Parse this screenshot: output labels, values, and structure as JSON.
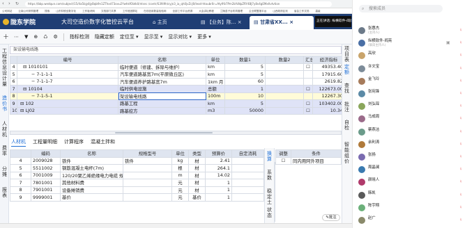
{
  "browser": {
    "url": "https://bbp.wedqun.com/subject/15/4a5bjy8jyBqb9n1ZThxd73ovu2YwhkfObtk0/ntsnc /contr/S39i9h/cyjn3_ia_qh0jvZcJ0/leod-htoubr0r=Aty9fz7Pm2b%NpZRY4BJ7y8v4gEMxtlvtvtion",
    "bookmarks": [
      "公司网站",
      "云南公司采购管理",
      "搜索",
      "山东财税全数字化",
      "工作板块网",
      "文档部门共享",
      "工作班团群站",
      "在线信用数量检验网",
      "全部工作平台资源",
      "大会讲坛教程",
      "兰陵县子台机构管理",
      "企业联盟报平台",
      "山西政府区划",
      "省会工作文档",
      "高级"
    ]
  },
  "app": {
    "logo": "陇东学院",
    "title": "大司空造价数字化管控云平台",
    "tabs": [
      {
        "label": "主页"
      },
      {
        "label": "【业务】陈..."
      },
      {
        "label": "甘肃省XX..."
      }
    ],
    "right_badge": "正在讲话: 纵横软件-阎亮"
  },
  "toolbar": {
    "items": [
      "十",
      "⋯",
      "▼",
      "⊕",
      "♺",
      "⚙",
      "指标检测",
      "隐藏定额",
      "定位至 ▾",
      "显示至 ▾",
      "显示对比 ▾",
      "更多 ▾"
    ]
  },
  "leftnav": {
    "items": [
      "工程信息",
      "设计量",
      "造价书",
      "人材机",
      "费率",
      "分摊",
      "报表"
    ]
  },
  "editbar": {
    "value": "架设输电线路"
  },
  "main_grid": {
    "headers": [
      "",
      "编号",
      "名称",
      "单位",
      "数量1",
      "数量2",
      "汇总",
      "经济指标",
      "金额"
    ],
    "rows": [
      {
        "no": "4",
        "code": "⊟  1010101",
        "name": "临时便道（修建、拆除与维护）",
        "unit": "km",
        "q1": "5",
        "q2": "",
        "sum": "☐",
        "eco": "49353.40",
        "amt": "",
        "style": "normal"
      },
      {
        "no": "5",
        "code": "− 7-1-1-1",
        "name": "汽车便道路基宽7m(平原微丘区)",
        "unit": "km",
        "q1": "5",
        "q2": "",
        "sum": "",
        "eco": "17915.60",
        "amt": "",
        "style": "normal"
      },
      {
        "no": "6",
        "code": "− 7-1-1-7",
        "name": "汽车便道养护路基宽7m",
        "unit": "1km 月",
        "q1": "60",
        "q2": "",
        "sum": "",
        "eco": "2619.82",
        "amt": "",
        "style": "normal"
      },
      {
        "no": "7",
        "code": "⊟  10104",
        "name": "临时供电设施",
        "unit": "总额",
        "q1": "1",
        "q2": "",
        "sum": "☐",
        "eco": "122673.00",
        "amt": "",
        "style": "blue"
      },
      {
        "no": "8",
        "code": "− 7-1-5-1",
        "name": "架设输电线路",
        "unit": "100m",
        "q1": "10",
        "q2": "",
        "sum": "",
        "eco": "12267.30",
        "amt": "",
        "style": "yellow"
      },
      {
        "no": "9",
        "code": "⊟  102",
        "name": "路基工程",
        "unit": "km",
        "q1": "5",
        "q2": "",
        "sum": "☐",
        "eco": "103402.00",
        "amt": "",
        "style": "blue"
      },
      {
        "no": "10",
        "code": "⊟  LJ02",
        "name": "路基挖方",
        "unit": "m3",
        "q1": "50000",
        "q2": "",
        "sum": "☐",
        "eco": "10.34",
        "amt": "",
        "style": "blue"
      }
    ]
  },
  "lower_tabs": [
    "人材机",
    "工程量明细",
    "计算程序",
    "混凝土拌和"
  ],
  "lower_grid": {
    "headers": [
      "",
      "编码",
      "名称",
      "规格型号",
      "单位",
      "类型",
      "预算价",
      "自定消耗"
    ],
    "rows": [
      {
        "no": "4",
        "code": "2009028",
        "name": "铁件",
        "spec": "铁件",
        "unit": "kg",
        "type": "材",
        "price": "2.41"
      },
      {
        "no": "5",
        "code": "5511002",
        "name": "钢筋混凝土电杆(7m)",
        "spec": "",
        "unit": "根",
        "type": "材",
        "price": "264.1"
      },
      {
        "no": "6",
        "code": "7001009",
        "name": "120/20聚乙烯绝缘电力电缆 规格120/20",
        "spec": "",
        "unit": "m",
        "type": "材",
        "price": "14.02"
      },
      {
        "no": "7",
        "code": "7801001",
        "name": "其他材料费",
        "spec": "",
        "unit": "元",
        "type": "材",
        "price": "1"
      },
      {
        "no": "8",
        "code": "7901001",
        "name": "设备摊销费",
        "spec": "",
        "unit": "元",
        "type": "材",
        "price": "1"
      },
      {
        "no": "9",
        "code": "9999001",
        "name": "基价",
        "spec": "",
        "unit": "元",
        "type": "基价",
        "price": "1"
      }
    ]
  },
  "lower_side": [
    "换算",
    "系数",
    "稳定土",
    "状态"
  ],
  "adjust_grid": {
    "headers": [
      "调整",
      "条件"
    ],
    "rows": [
      {
        "check": "☐",
        "cond": "同内用阿外项目"
      }
    ]
  },
  "right_strip": [
    "项目表",
    "定额",
    "查找",
    "批注",
    "自检",
    "智能组价"
  ],
  "right_button": "批注",
  "chat": {
    "search_placeholder": "搜索成员",
    "people": [
      {
        "name": "张惠杰",
        "sub": "(主持人)",
        "color": "#6c7a89"
      },
      {
        "name": "纵横软件-阎亮",
        "sub": "(联席主持人)",
        "color": "#4a6fa5"
      },
      {
        "name": "高欣",
        "sub": "",
        "color": "#c9a46b"
      },
      {
        "name": "许文宝",
        "sub": "",
        "color": "#7d8c99"
      },
      {
        "name": "金飞玲",
        "sub": "",
        "color": "#a67b5b"
      },
      {
        "name": "张宛锋",
        "sub": "",
        "color": "#5b8aa6"
      },
      {
        "name": "刘弘琛",
        "sub": "",
        "color": "#8aa65b"
      },
      {
        "name": "马成周",
        "sub": "",
        "color": "#9b6b8a"
      },
      {
        "name": "蔡燕洁",
        "sub": "",
        "color": "#6b9b8a"
      },
      {
        "name": "余利涛",
        "sub": "",
        "color": "#b07a3a"
      },
      {
        "name": "张扬",
        "sub": "",
        "color": "#7a6bb0"
      },
      {
        "name": "周晶澜",
        "sub": "",
        "color": "#3a7ab0"
      },
      {
        "name": "颜晓人",
        "sub": "",
        "color": "#b03a6b"
      },
      {
        "name": "韩凯",
        "sub": "",
        "color": "#5a5a5a"
      },
      {
        "name": "陈宇翔",
        "sub": "",
        "color": "#6bb07a"
      },
      {
        "name": "赵广",
        "sub": "",
        "color": "#8a8a6b"
      }
    ]
  }
}
